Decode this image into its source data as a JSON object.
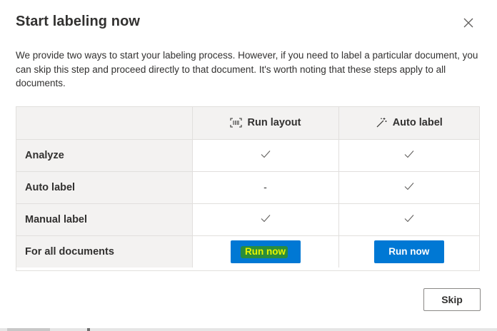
{
  "dialog": {
    "title": "Start labeling now",
    "description": "We provide two ways to start your labeling process. However, if you need to label a particular document, you can skip this step and proceed directly to that document. It's worth noting that these steps apply to all documents.",
    "close_icon": "close-icon"
  },
  "grid": {
    "columns": [
      {
        "label": "Run layout",
        "icon": "layout-scan-icon"
      },
      {
        "label": "Auto label",
        "icon": "magic-wand-icon"
      }
    ],
    "rows": [
      {
        "label": "Analyze",
        "values": [
          "check",
          "check"
        ]
      },
      {
        "label": "Auto label",
        "values": [
          "-",
          "check"
        ]
      },
      {
        "label": "Manual label",
        "values": [
          "check",
          "check"
        ]
      },
      {
        "label": "For all documents",
        "values": [
          "Run now",
          "Run now"
        ]
      }
    ]
  },
  "footer": {
    "skip_label": "Skip"
  },
  "colors": {
    "primary": "#0078d4",
    "border": "#e1dfdd",
    "header_bg": "#f3f2f1",
    "highlight": "#2f8f2a"
  }
}
